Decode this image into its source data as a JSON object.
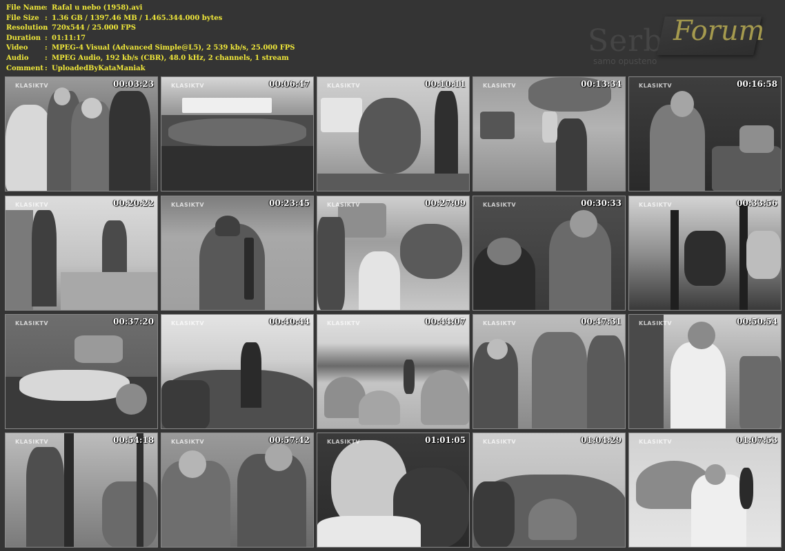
{
  "info": {
    "rows": [
      {
        "label": "File Name",
        "value": "Rafal u nebo (1958).avi"
      },
      {
        "label": "File Size",
        "value": "1.36 GB  / 1397.46 MB  / 1.465.344.000  bytes"
      },
      {
        "label": "Resolution",
        "value": "720x544 / 25.000 FPS"
      },
      {
        "label": "Duration",
        "value": "01:11:17"
      },
      {
        "label": "Video",
        "value": "MPEG-4 Visual (Advanced Simple@L5), 2 539 kb/s, 25.000 FPS"
      },
      {
        "label": "Audio",
        "value": "MPEG Audio, 192 kb/s (CBR), 48.0 kHz, 2 channels, 1 stream"
      },
      {
        "label": "Comment",
        "value": "UploadedByKataManiak"
      }
    ],
    "separator": ":"
  },
  "logo": {
    "word": "Serbian",
    "forum": "Forum",
    "tagline": "samo opusteno"
  },
  "watermark": "KLASIKTV",
  "thumbnails": [
    {
      "time": "00:03:23",
      "scene": "men-horse"
    },
    {
      "time": "00:06:47",
      "scene": "crowd-banner"
    },
    {
      "time": "00:10:11",
      "scene": "village-soldier"
    },
    {
      "time": "00:13:34",
      "scene": "road-soldiers"
    },
    {
      "time": "00:16:58",
      "scene": "soldier-wood"
    },
    {
      "time": "00:20:22",
      "scene": "hall-soldiers"
    },
    {
      "time": "00:23:45",
      "scene": "soldier-back"
    },
    {
      "time": "00:27:09",
      "scene": "village-road"
    },
    {
      "time": "00:30:33",
      "scene": "two-men-sitting"
    },
    {
      "time": "00:33:56",
      "scene": "group-forest"
    },
    {
      "time": "00:37:20",
      "scene": "man-ground"
    },
    {
      "time": "00:40:44",
      "scene": "hill-soldier"
    },
    {
      "time": "00:44:07",
      "scene": "haystacks"
    },
    {
      "time": "00:47:31",
      "scene": "three-soldiers"
    },
    {
      "time": "00:50:54",
      "scene": "man-white-shirt"
    },
    {
      "time": "00:54:18",
      "scene": "forest-fight"
    },
    {
      "time": "00:57:42",
      "scene": "two-soldiers"
    },
    {
      "time": "01:01:05",
      "scene": "closeup-faces"
    },
    {
      "time": "01:04:29",
      "scene": "landscape-hay"
    },
    {
      "time": "01:07:53",
      "scene": "man-hay-bright"
    }
  ],
  "palette": {
    "background": "#343434",
    "info_text": "#f2ea3a",
    "logo_gold": "#a59a4e",
    "thumb_border": "#8a8a8a"
  }
}
